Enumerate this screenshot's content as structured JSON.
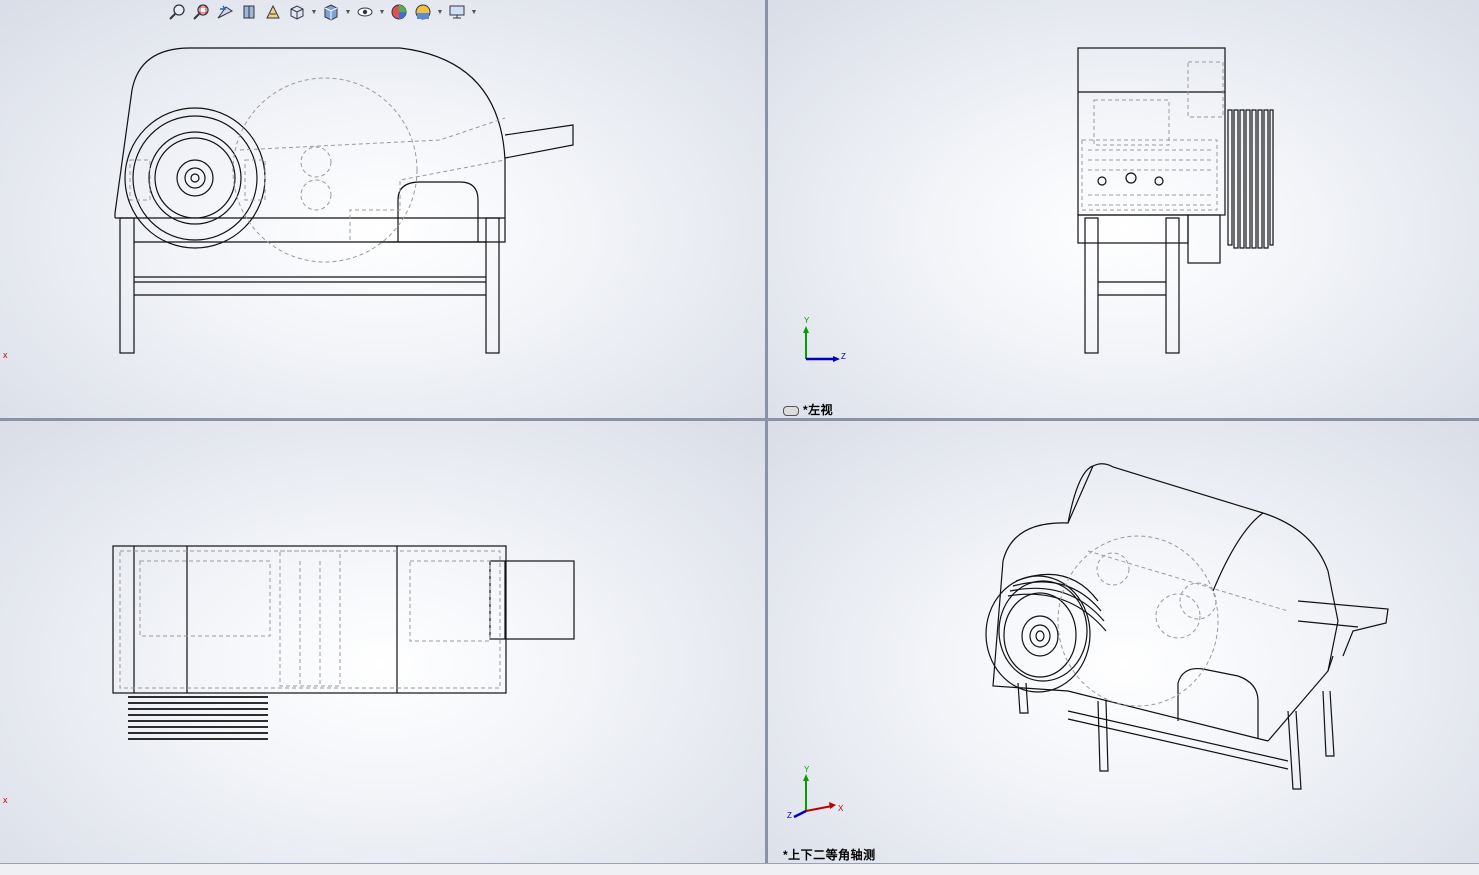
{
  "toolbar": {
    "icons": [
      "zoom-to-fit-icon",
      "zoom-to-area-icon",
      "previous-view-icon",
      "section-view-icon",
      "dynamic-annotation-icon",
      "view-orientation-icon",
      "display-style-icon",
      "hide-show-items-icon",
      "edit-appearance-icon",
      "apply-scene-icon",
      "view-settings-icon"
    ]
  },
  "viewports": {
    "top_left": {
      "axis_marker": "x"
    },
    "top_right": {
      "label": "*左视",
      "triad": {
        "y": "Y",
        "z": "Z"
      }
    },
    "bottom_left": {
      "axis_marker": "x"
    },
    "bottom_right": {
      "label": "*上下二等角轴测",
      "triad": {
        "y": "Y",
        "x": "X",
        "z": "Z"
      }
    }
  },
  "colors": {
    "viewport_center": "#ffffff",
    "viewport_edge": "#d9dde7",
    "divider": "#8a93a5",
    "line": "#111111",
    "hidden_line": "#9a9a9a",
    "axis_x": "#c00000",
    "axis_y": "#00a000",
    "axis_z": "#0000c0"
  }
}
